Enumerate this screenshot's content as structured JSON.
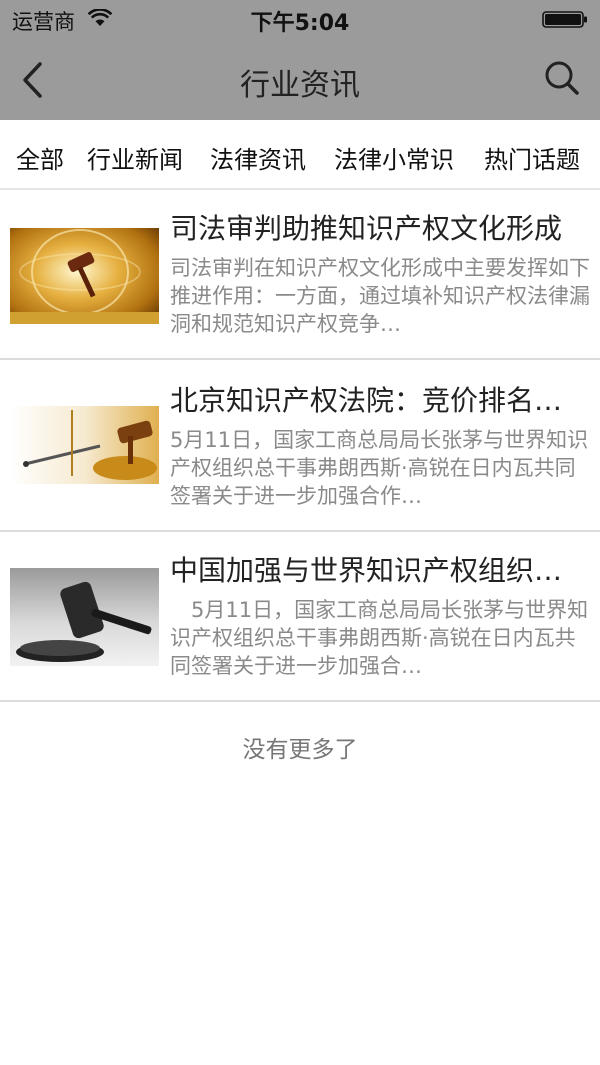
{
  "status_bar": {
    "carrier": "运营商",
    "time": "下午5:04"
  },
  "nav": {
    "title": "行业资讯",
    "back_icon": "chevron-left-icon",
    "search_icon": "search-icon"
  },
  "tabs": [
    "全部",
    "行业新闻",
    "法律资讯",
    "法律小常识",
    "热门话题"
  ],
  "articles": [
    {
      "title": "司法审判助推知识产权文化形成",
      "summary": "司法审判在知识产权文化形成中主要发挥如下推进作用：一方面，通过填补知识产权法律漏洞和规范知识产权竞争…"
    },
    {
      "title": "北京知识产权法院：竞价排名…",
      "summary": "5月11日，国家工商总局局长张茅与世界知识产权组织总干事弗朗西斯·高锐在日内瓦共同签署关于进一步加强合作…"
    },
    {
      "title": "中国加强与世界知识产权组织…",
      "summary": "　5月11日，国家工商总局局长张茅与世界知识产权组织总干事弗朗西斯·高锐在日内瓦共同签署关于进一步加强合…"
    }
  ],
  "footer": {
    "no_more": "没有更多了"
  },
  "colors": {
    "header_bg": "#9b9b9b",
    "divider": "#dcdcdc"
  }
}
